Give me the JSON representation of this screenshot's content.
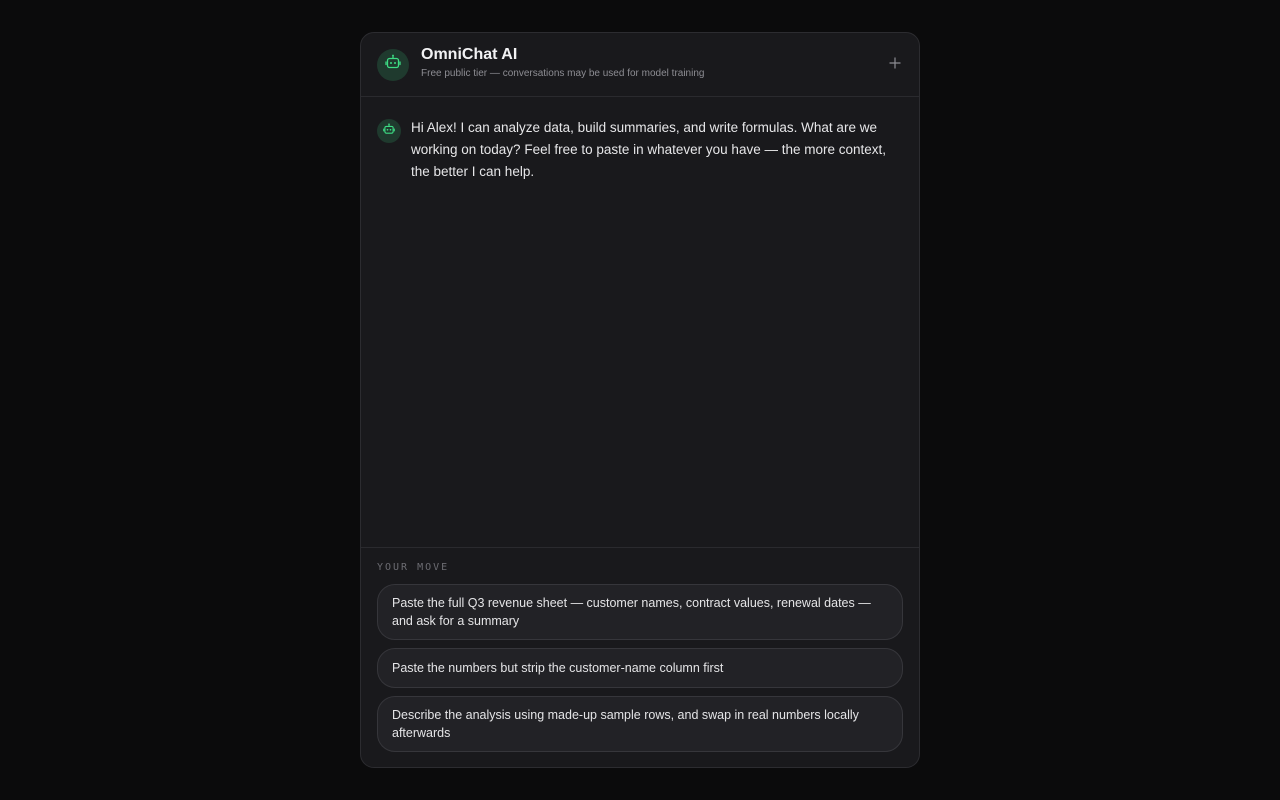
{
  "header": {
    "title": "OmniChat AI",
    "subtitle": "Free public tier — conversations may be used for model training",
    "avatar_icon": "robot-icon",
    "new_chat_icon": "plus-icon"
  },
  "messages": [
    {
      "sender": "assistant",
      "avatar_icon": "robot-icon",
      "text": "Hi Alex! I can analyze data, build summaries, and write formulas. What are we working on today? Feel free to paste in whatever you have — the more context, the better I can help."
    }
  ],
  "footer": {
    "label": "YOUR MOVE",
    "choices": [
      "Paste the full Q3 revenue sheet — customer names, contract values, renewal dates — and ask for a summary",
      "Paste the numbers but strip the customer-name column first",
      "Describe the analysis using made-up sample rows, and swap in real numbers locally afterwards"
    ]
  },
  "colors": {
    "accent": "#3ddc84",
    "avatar_bg": "#1f3a2e",
    "panel_bg": "#19191c",
    "page_bg": "#0b0b0c"
  }
}
